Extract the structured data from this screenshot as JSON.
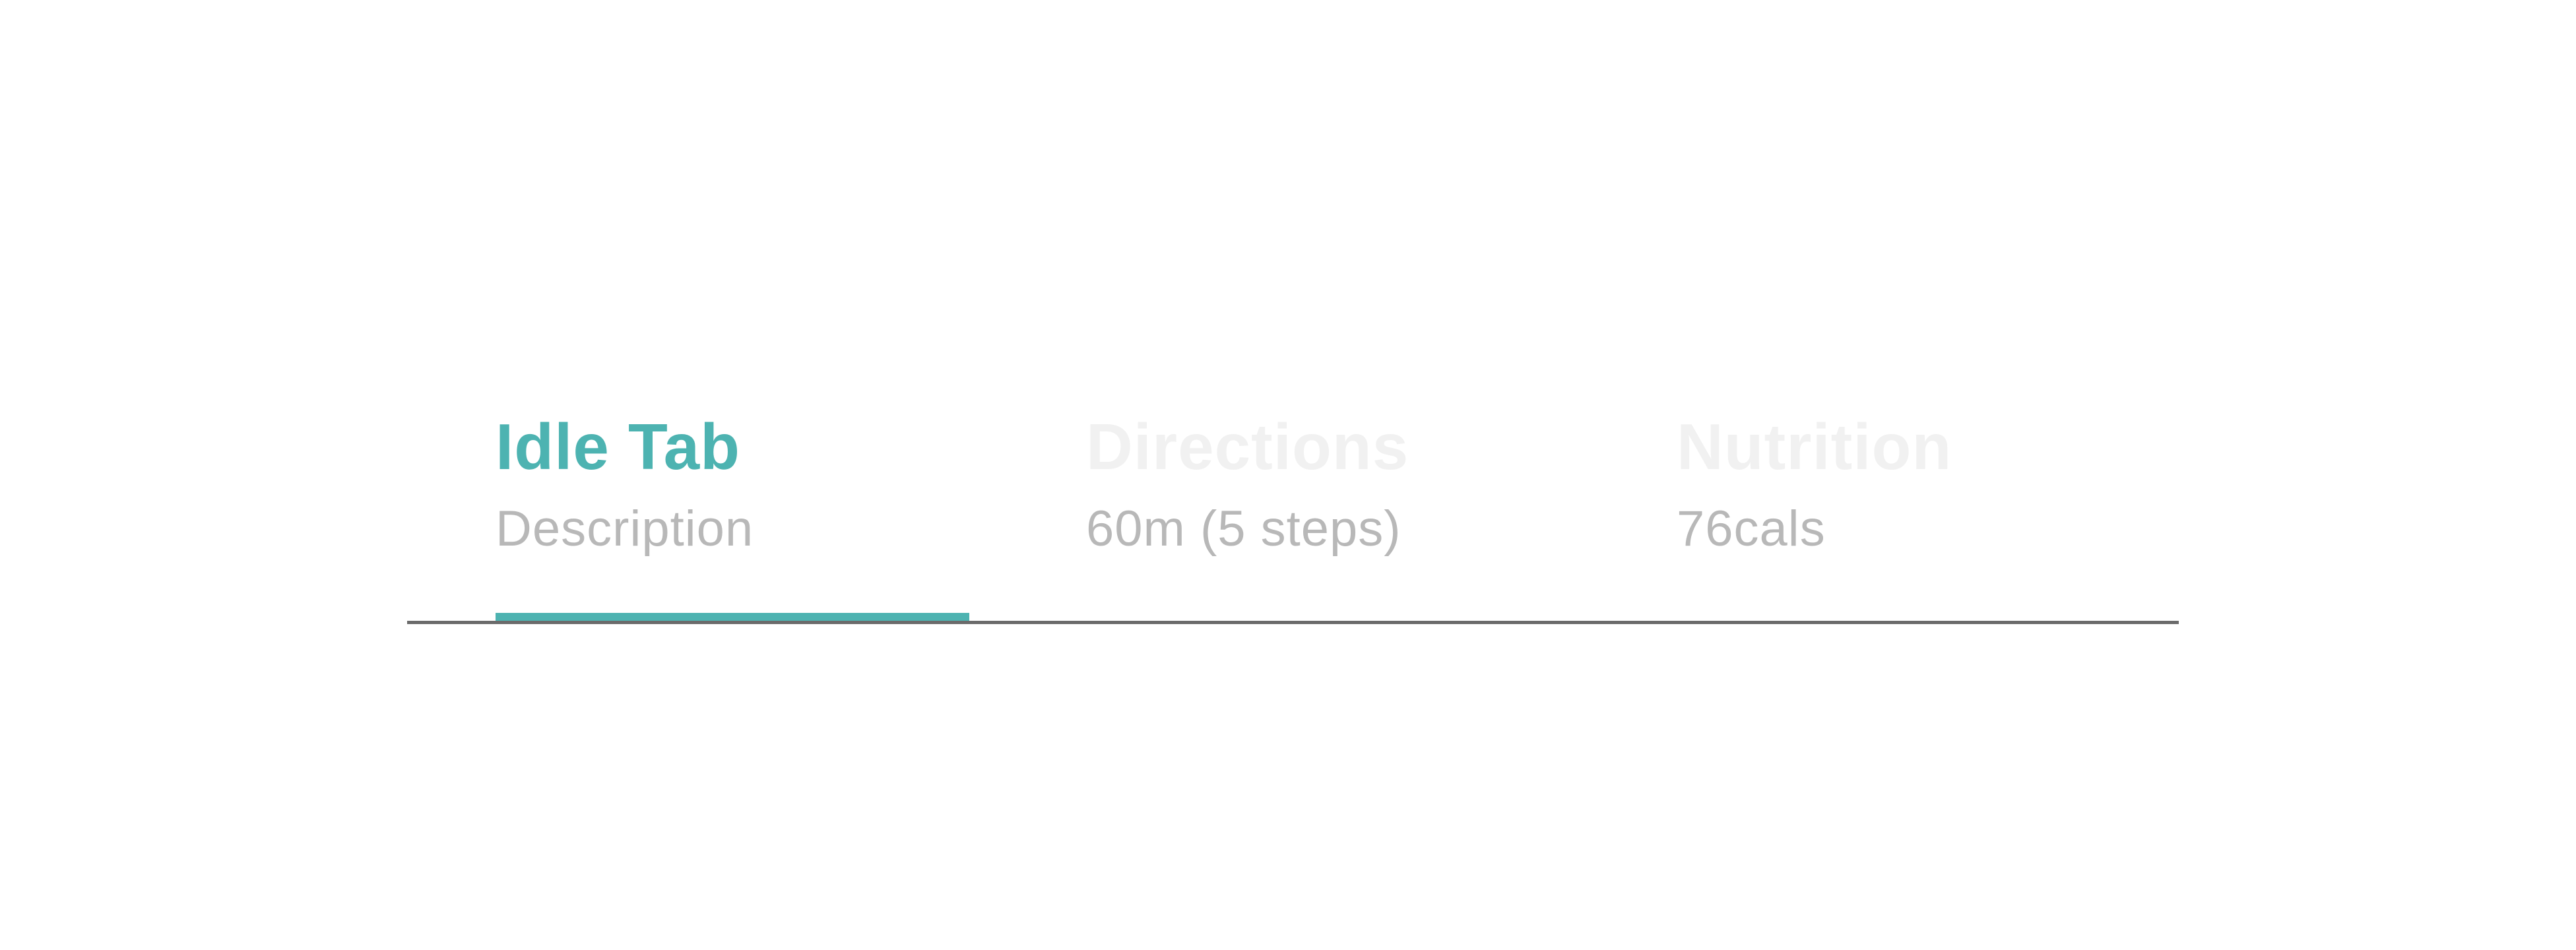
{
  "colors": {
    "accent": "#4db3b1",
    "inactive_title": "#f1f1f1",
    "subtitle": "#b8b8b8",
    "divider": "#6b6b6b"
  },
  "tabs": [
    {
      "title": "Idle Tab",
      "subtitle": "Description",
      "active": true
    },
    {
      "title": "Directions",
      "subtitle": "60m (5 steps)",
      "active": false
    },
    {
      "title": "Nutrition",
      "subtitle": "76cals",
      "active": false
    }
  ]
}
